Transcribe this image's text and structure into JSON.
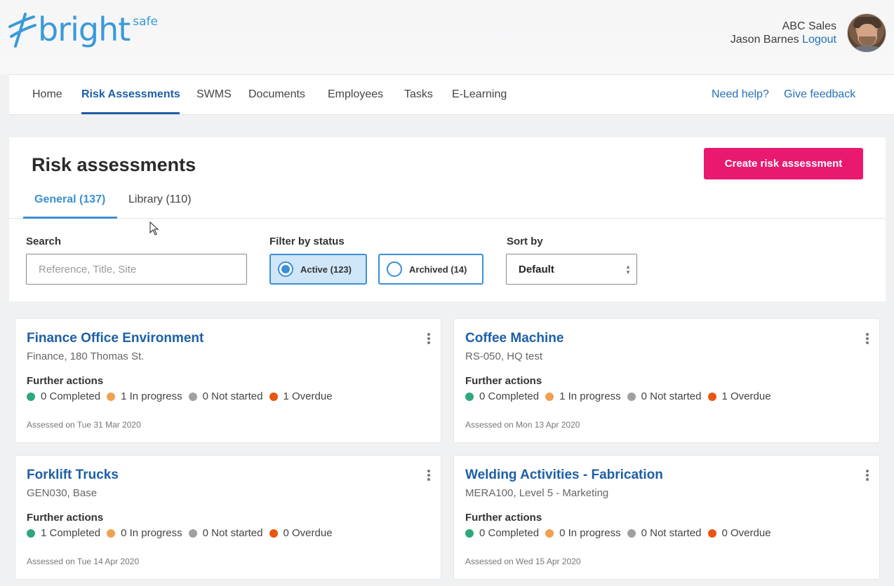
{
  "brand": {
    "name": "bright",
    "superscript": "safe",
    "color": "#3a9ad9"
  },
  "user": {
    "company": "ABC Sales",
    "name": "Jason Barnes",
    "logout_label": "Logout"
  },
  "nav": {
    "items": [
      {
        "label": "Home"
      },
      {
        "label": "Risk Assessments"
      },
      {
        "label": "SWMS"
      },
      {
        "label": "Documents"
      },
      {
        "label": "Employees"
      },
      {
        "label": "Tasks"
      },
      {
        "label": "E-Learning"
      }
    ],
    "active_index": 1,
    "help_label": "Need help?",
    "feedback_label": "Give feedback"
  },
  "page": {
    "title": "Risk assessments",
    "create_button": "Create risk assessment",
    "create_button_color": "#e8196f",
    "tabs": [
      {
        "label": "General (137)",
        "active": true
      },
      {
        "label": "Library (110)",
        "active": false
      }
    ]
  },
  "filters": {
    "search_label": "Search",
    "search_placeholder": "Reference, Title, Site",
    "search_value": "",
    "status_label": "Filter by status",
    "status_options": [
      {
        "label": "Active (123)",
        "selected": true
      },
      {
        "label": "Archived (14)",
        "selected": false
      }
    ],
    "sort_label": "Sort by",
    "sort_value": "Default"
  },
  "status_colors": {
    "completed": "#2ea87a",
    "in_progress": "#f0a050",
    "not_started": "#a0a0a0",
    "overdue": "#e8560f"
  },
  "cards": [
    {
      "title": "Finance Office Environment",
      "subtitle": "Finance, 180 Thomas St.",
      "actions_label": "Further actions",
      "completed": "0 Completed",
      "in_progress": "1 In progress",
      "not_started": "0 Not started",
      "overdue": "1 Overdue",
      "assessed": "Assessed on Tue 31 Mar 2020"
    },
    {
      "title": "Coffee Machine",
      "subtitle": "RS-050, HQ test",
      "actions_label": "Further actions",
      "completed": "0 Completed",
      "in_progress": "1 In progress",
      "not_started": "0 Not started",
      "overdue": "1 Overdue",
      "assessed": "Assessed on Mon 13 Apr 2020"
    },
    {
      "title": "Forklift Trucks",
      "subtitle": "GEN030, Base",
      "actions_label": "Further actions",
      "completed": "1 Completed",
      "in_progress": "0 In progress",
      "not_started": "0 Not started",
      "overdue": "0 Overdue",
      "assessed": "Assessed on Tue 14 Apr 2020"
    },
    {
      "title": "Welding Activities - Fabrication",
      "subtitle": "MERA100, Level 5 - Marketing",
      "actions_label": "Further actions",
      "completed": "0 Completed",
      "in_progress": "0 In progress",
      "not_started": "0 Not started",
      "overdue": "0 Overdue",
      "assessed": "Assessed on Wed 15 Apr 2020"
    }
  ]
}
